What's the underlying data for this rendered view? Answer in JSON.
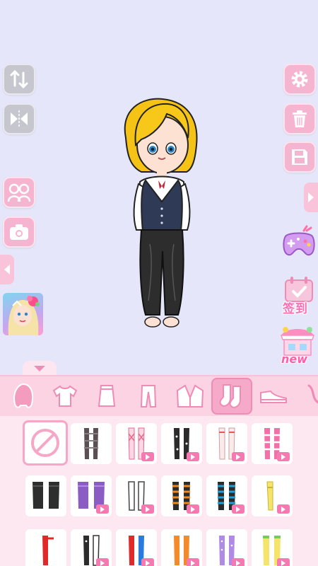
{
  "left_tools": [
    {
      "icon": "swap-vertical-icon"
    },
    {
      "icon": "mirror-flip-icon"
    },
    {
      "icon": "couple-icon"
    },
    {
      "icon": "camera-icon"
    },
    {
      "icon": "arrow-left-icon"
    }
  ],
  "right_tools": [
    {
      "icon": "gear-icon"
    },
    {
      "icon": "trash-icon"
    },
    {
      "icon": "save-icon"
    },
    {
      "icon": "arrow-right-icon"
    },
    {
      "icon": "gamepad-icon"
    }
  ],
  "signin": {
    "label": "签到"
  },
  "shop": {
    "label": "new"
  },
  "categories": [
    {
      "icon": "hair-icon"
    },
    {
      "icon": "shirt-icon"
    },
    {
      "icon": "skirt-icon"
    },
    {
      "icon": "pants-icon"
    },
    {
      "icon": "jacket-icon"
    },
    {
      "icon": "socks-icon",
      "selected": true
    },
    {
      "icon": "shoe-icon"
    },
    {
      "icon": "accessory-icon"
    }
  ],
  "colors": {
    "accent": "#f57ab1",
    "panel": "#fde7f0",
    "category_bar": "#fbd3e3",
    "stage": "#e6e6fa"
  }
}
